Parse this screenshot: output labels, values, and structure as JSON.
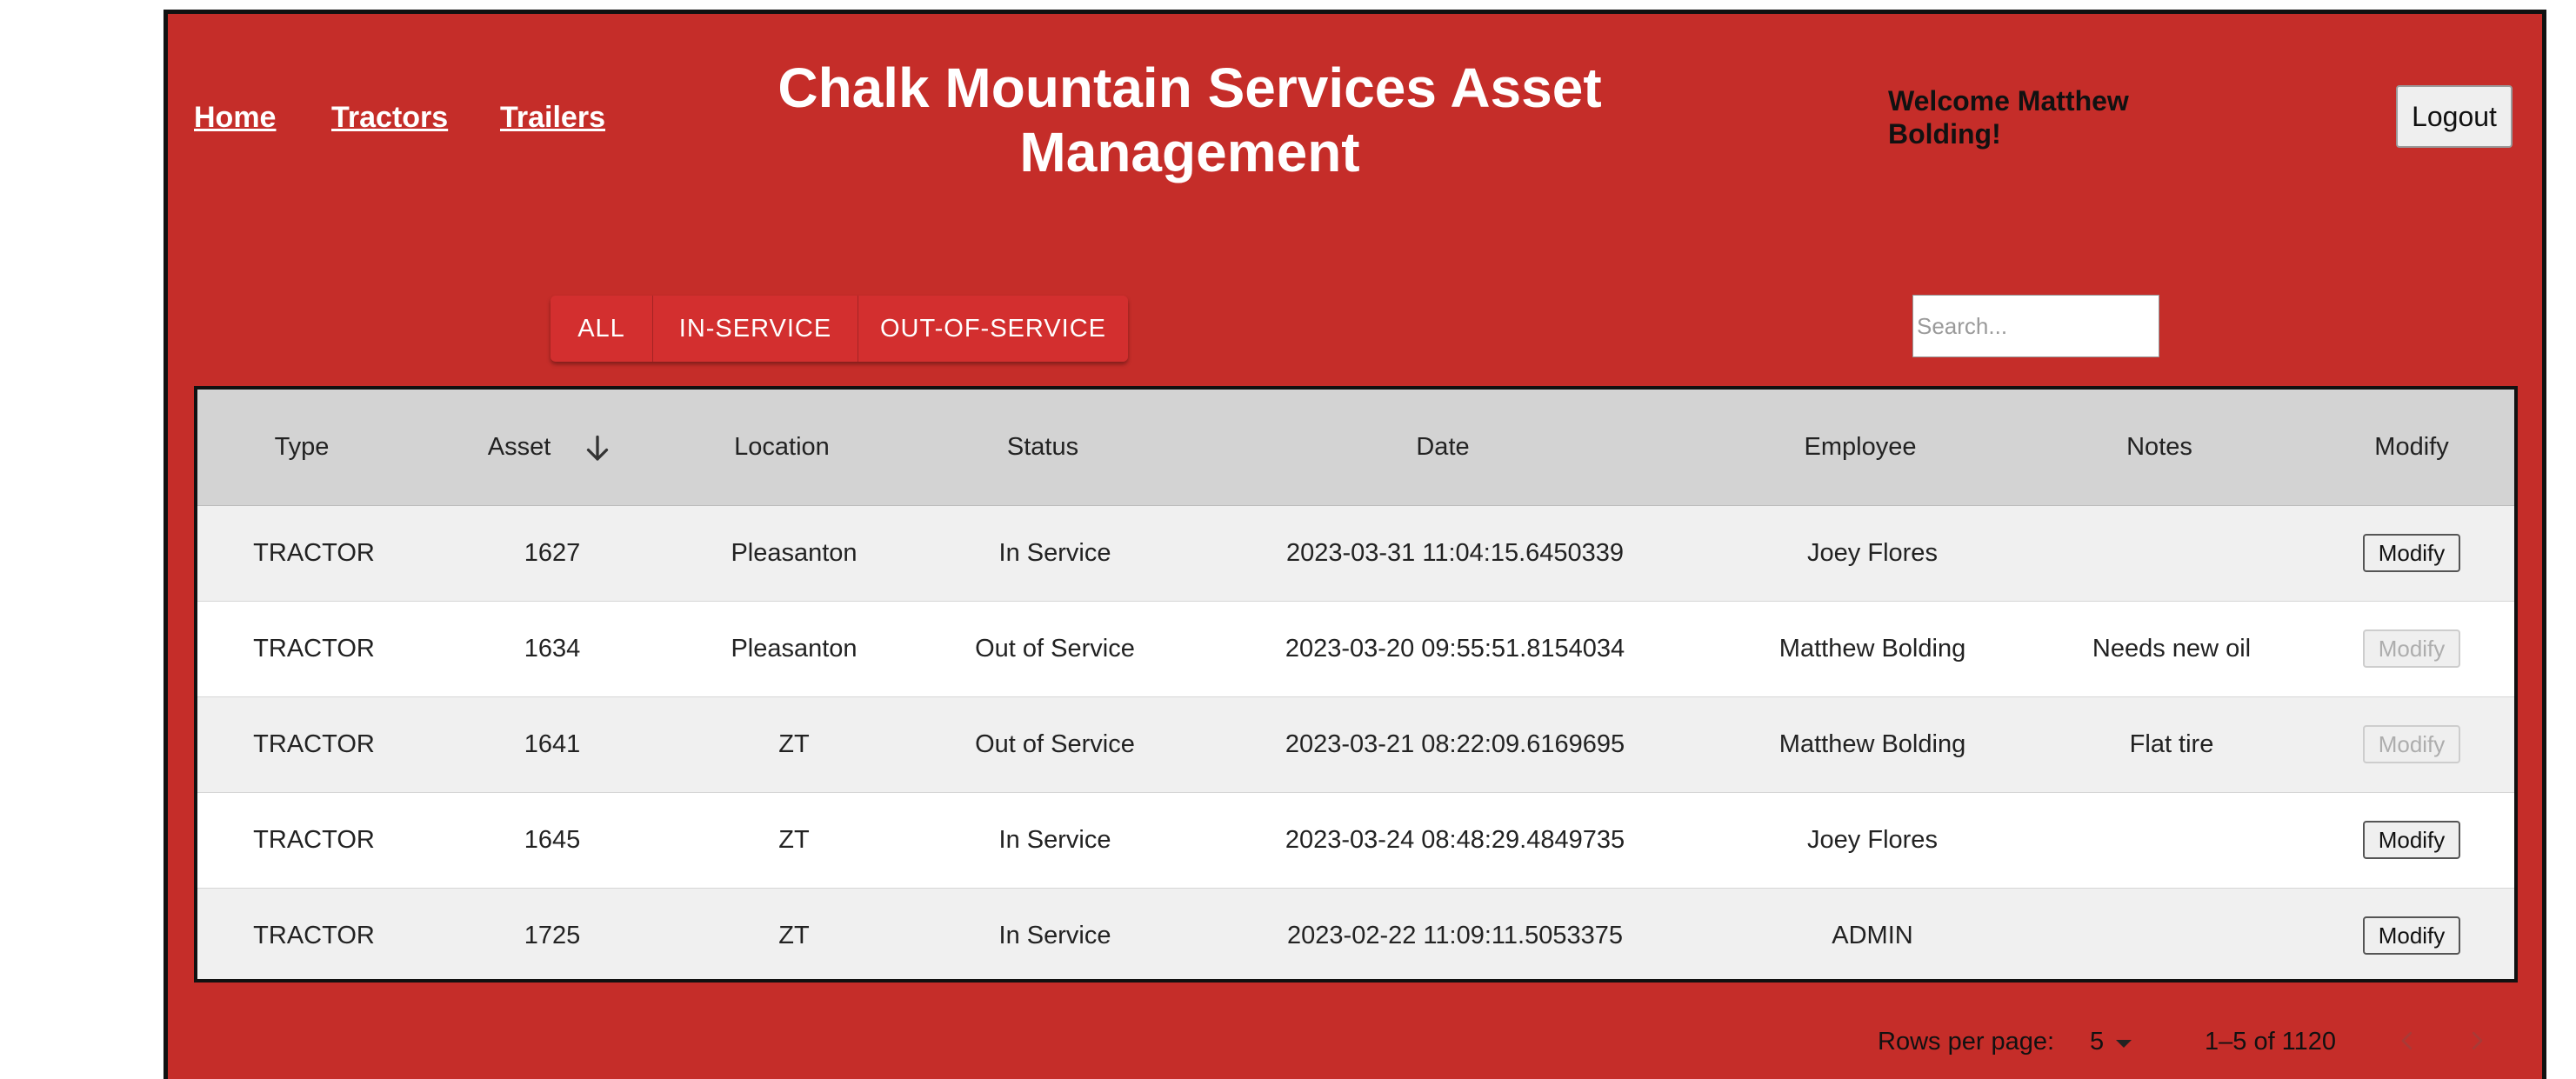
{
  "nav": {
    "home": "Home",
    "tractors": "Tractors",
    "trailers": "Trailers"
  },
  "header": {
    "title": "Chalk Mountain Services Asset Management",
    "welcome": "Welcome Matthew Bolding!",
    "logout": "Logout"
  },
  "filters": [
    "ALL",
    "IN-SERVICE",
    "OUT-OF-SERVICE"
  ],
  "search": {
    "placeholder": "Search..."
  },
  "table": {
    "columns": [
      "Type",
      "Asset",
      "Location",
      "Status",
      "Date",
      "Employee",
      "Notes",
      "Modify"
    ],
    "sort": {
      "column": "Asset",
      "direction": "descending",
      "icon": "arrow-down-icon"
    },
    "rows": [
      {
        "type": "TRACTOR",
        "asset": "1627",
        "location": "Pleasanton",
        "status": "In Service",
        "date": "2023-03-31 11:04:15.6450339",
        "employee": "Joey Flores",
        "notes": "",
        "modify": "Modify",
        "modify_enabled": true
      },
      {
        "type": "TRACTOR",
        "asset": "1634",
        "location": "Pleasanton",
        "status": "Out of Service",
        "date": "2023-03-20 09:55:51.8154034",
        "employee": "Matthew Bolding",
        "notes": "Needs new oil",
        "modify": "Modify",
        "modify_enabled": false
      },
      {
        "type": "TRACTOR",
        "asset": "1641",
        "location": "ZT",
        "status": "Out of Service",
        "date": "2023-03-21 08:22:09.6169695",
        "employee": "Matthew Bolding",
        "notes": "Flat tire",
        "modify": "Modify",
        "modify_enabled": false
      },
      {
        "type": "TRACTOR",
        "asset": "1645",
        "location": "ZT",
        "status": "In Service",
        "date": "2023-03-24 08:48:29.4849735",
        "employee": "Joey Flores",
        "notes": "",
        "modify": "Modify",
        "modify_enabled": true
      },
      {
        "type": "TRACTOR",
        "asset": "1725",
        "location": "ZT",
        "status": "In Service",
        "date": "2023-02-22 11:09:11.5053375",
        "employee": "ADMIN",
        "notes": "",
        "modify": "Modify",
        "modify_enabled": true
      }
    ]
  },
  "pagination": {
    "rows_per_page_label": "Rows per page:",
    "rows_per_page": "5",
    "range": "1–5 of 1120"
  },
  "colors": {
    "brand": "#c52d29",
    "filter_button": "#d32f2f",
    "header_row": "#d3d3d3"
  }
}
